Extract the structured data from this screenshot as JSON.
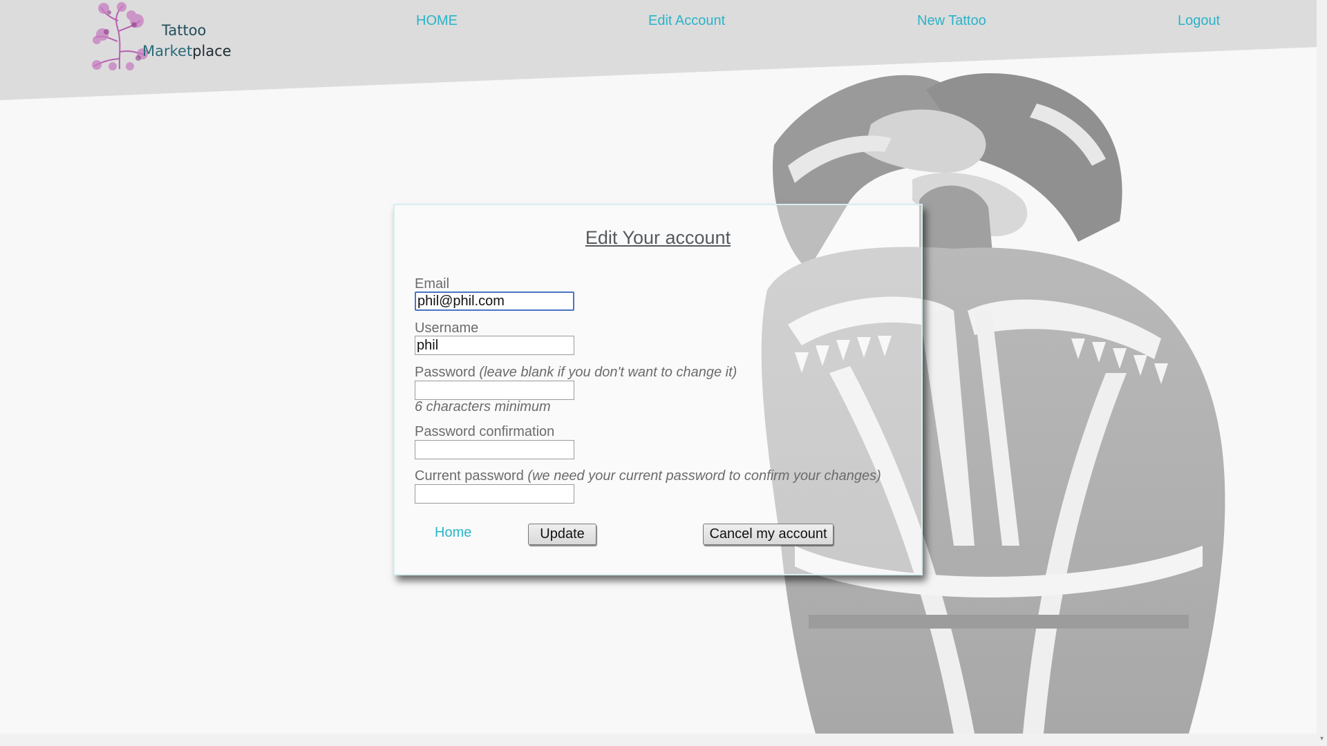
{
  "brand": {
    "line1": "Tattoo",
    "line2_part1": "Market",
    "line2_part2": "place"
  },
  "nav": {
    "home": "HOME",
    "edit_account": "Edit Account",
    "new_tattoo": "New Tattoo",
    "logout": "Logout"
  },
  "form": {
    "title": "Edit Your account",
    "email_label": "Email",
    "email_value": "phil@phil.com",
    "username_label": "Username",
    "username_value": "phil",
    "password_label": "Password",
    "password_note": "(leave blank if you don't want to change it)",
    "password_value": "",
    "password_hint": "6 characters minimum",
    "password_confirmation_label": "Password confirmation",
    "password_confirmation_value": "",
    "current_password_label": "Current password",
    "current_password_note": "(we need your current password to confirm your changes)",
    "current_password_value": "",
    "home_link": "Home",
    "update_button": "Update",
    "cancel_button": "Cancel my account"
  },
  "colors": {
    "link": "#2ab3c8",
    "header_bg": "#dcdcdc",
    "focus": "#4a73c4"
  }
}
